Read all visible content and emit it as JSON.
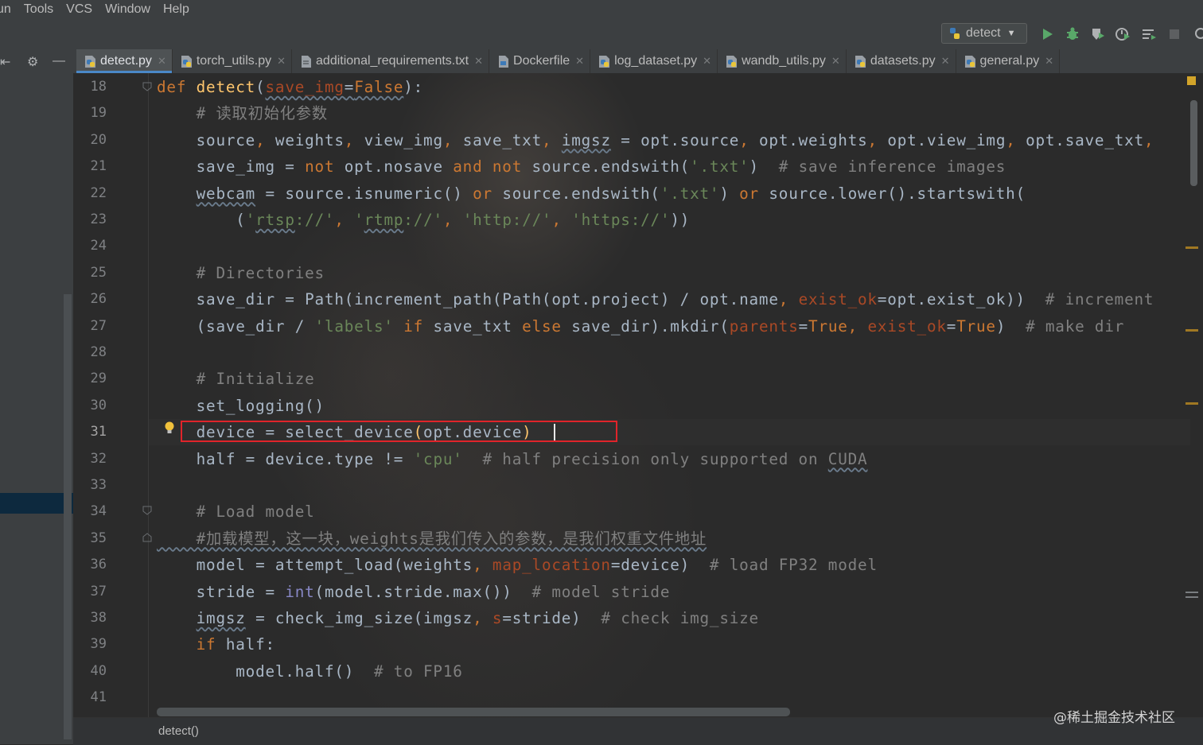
{
  "menu": [
    "un",
    "Tools",
    "VCS",
    "Window",
    "Help"
  ],
  "run_config": {
    "label": "detect",
    "icon": "python-file-icon"
  },
  "toolbar_icons": [
    "run-icon",
    "debug-icon",
    "coverage-icon",
    "profile-icon",
    "build-icon",
    "stop-icon"
  ],
  "tabs": [
    {
      "label": "detect.py",
      "icon": "python-file-icon",
      "active": true
    },
    {
      "label": "torch_utils.py",
      "icon": "python-file-icon"
    },
    {
      "label": "additional_requirements.txt",
      "icon": "text-file-icon"
    },
    {
      "label": "Dockerfile",
      "icon": "docker-file-icon"
    },
    {
      "label": "log_dataset.py",
      "icon": "python-file-icon"
    },
    {
      "label": "wandb_utils.py",
      "icon": "python-file-icon"
    },
    {
      "label": "datasets.py",
      "icon": "python-file-icon"
    },
    {
      "label": "general.py",
      "icon": "python-file-icon"
    }
  ],
  "editor": {
    "current_line": 31,
    "lines": [
      {
        "n": "18",
        "t": [
          [
            "kw",
            "def "
          ],
          [
            "fn",
            "detect"
          ],
          [
            "",
            "("
          ],
          [
            "par wavy",
            "save_img"
          ],
          [
            "wavy",
            "="
          ],
          [
            "kw wavy",
            "False"
          ],
          [
            "",
            "):"
          ]
        ]
      },
      {
        "n": "19",
        "t": [
          [
            "cm",
            "    # 读取初始化参数"
          ]
        ]
      },
      {
        "n": "20",
        "t": [
          [
            "",
            "    source"
          ],
          [
            "kw",
            ", "
          ],
          [
            "",
            "weights"
          ],
          [
            "kw",
            ", "
          ],
          [
            "",
            "view_img"
          ],
          [
            "kw",
            ", "
          ],
          [
            "",
            "save_txt"
          ],
          [
            "kw",
            ", "
          ],
          [
            "wavy",
            "imgsz"
          ],
          [
            "",
            " = opt.source"
          ],
          [
            "kw",
            ", "
          ],
          [
            "",
            "opt.weights"
          ],
          [
            "kw",
            ", "
          ],
          [
            "",
            "opt.view_img"
          ],
          [
            "kw",
            ", "
          ],
          [
            "",
            "opt.save_txt"
          ],
          [
            "kw",
            ","
          ]
        ]
      },
      {
        "n": "21",
        "t": [
          [
            "",
            "    save_img = "
          ],
          [
            "kw",
            "not "
          ],
          [
            "",
            "opt.nosave "
          ],
          [
            "kw",
            "and not "
          ],
          [
            "",
            "source.endswith("
          ],
          [
            "str",
            "'.txt'"
          ],
          [
            "",
            ")  "
          ],
          [
            "cm",
            "# save inference images"
          ]
        ]
      },
      {
        "n": "22",
        "t": [
          [
            "",
            "    "
          ],
          [
            "wavy",
            "webcam"
          ],
          [
            "",
            " = source.isnumeric() "
          ],
          [
            "kw",
            "or "
          ],
          [
            "",
            "source.endswith("
          ],
          [
            "str",
            "'.txt'"
          ],
          [
            "",
            ") "
          ],
          [
            "kw",
            "or "
          ],
          [
            "",
            "source.lower().startswith("
          ]
        ]
      },
      {
        "n": "23",
        "t": [
          [
            "",
            "        ("
          ],
          [
            "str",
            "'"
          ],
          [
            "str wavy",
            "rtsp"
          ],
          [
            "str",
            "://'"
          ],
          [
            "kw",
            ", "
          ],
          [
            "str",
            "'"
          ],
          [
            "str wavy",
            "rtmp"
          ],
          [
            "str",
            "://'"
          ],
          [
            "kw",
            ", "
          ],
          [
            "str",
            "'http://'"
          ],
          [
            "kw",
            ", "
          ],
          [
            "str",
            "'https://'"
          ],
          [
            "",
            "))"
          ]
        ]
      },
      {
        "n": "24",
        "t": []
      },
      {
        "n": "25",
        "t": [
          [
            "cm",
            "    # Directories"
          ]
        ]
      },
      {
        "n": "26",
        "t": [
          [
            "",
            "    save_dir = Path(increment_path(Path(opt.project) / opt.name"
          ],
          [
            "kw",
            ", "
          ],
          [
            "par",
            "exist_ok"
          ],
          [
            "",
            "=opt.exist_ok))  "
          ],
          [
            "cm",
            "# increment"
          ]
        ]
      },
      {
        "n": "27",
        "t": [
          [
            "",
            "    (save_dir / "
          ],
          [
            "str",
            "'labels' "
          ],
          [
            "kw",
            "if "
          ],
          [
            "",
            "save_txt "
          ],
          [
            "kw",
            "else "
          ],
          [
            "",
            "save_dir).mkdir("
          ],
          [
            "par",
            "parents"
          ],
          [
            "",
            "="
          ],
          [
            "kw",
            "True"
          ],
          [
            "kw",
            ", "
          ],
          [
            "par",
            "exist_ok"
          ],
          [
            "",
            "="
          ],
          [
            "kw",
            "True"
          ],
          [
            ")",
            ")  "
          ],
          [
            "cm",
            "# make dir"
          ]
        ]
      },
      {
        "n": "28",
        "t": []
      },
      {
        "n": "29",
        "t": [
          [
            "cm",
            "    # Initialize"
          ]
        ]
      },
      {
        "n": "30",
        "t": [
          [
            "",
            "    set_logging()"
          ]
        ]
      },
      {
        "n": "31",
        "t": [
          [
            "",
            "    device = select_device"
          ],
          [
            "fn",
            "("
          ],
          [
            "",
            "opt.device"
          ],
          [
            "fn",
            ")"
          ]
        ]
      },
      {
        "n": "32",
        "t": [
          [
            "",
            "    half = device.type != "
          ],
          [
            "str",
            "'cpu'  "
          ],
          [
            "cm",
            "# half precision only supported on "
          ],
          [
            "cm wavy",
            "CUDA"
          ]
        ]
      },
      {
        "n": "33",
        "t": []
      },
      {
        "n": "34",
        "t": [
          [
            "cm",
            "    # Load model"
          ]
        ]
      },
      {
        "n": "35",
        "t": [
          [
            "cm wavy",
            "    #加载模型，这一块，weights是我们传入的参数，是我们权重文件地址"
          ]
        ]
      },
      {
        "n": "36",
        "t": [
          [
            "",
            "    model = attempt_load(weights"
          ],
          [
            "kw",
            ", "
          ],
          [
            "par",
            "map_location"
          ],
          [
            "",
            "=device)  "
          ],
          [
            "cm",
            "# load FP32 model"
          ]
        ]
      },
      {
        "n": "37",
        "t": [
          [
            "",
            "    stride = "
          ],
          [
            "bi",
            "int"
          ],
          [
            "",
            "(model.stride.max())  "
          ],
          [
            "cm",
            "# model stride"
          ]
        ]
      },
      {
        "n": "38",
        "t": [
          [
            "",
            "    "
          ],
          [
            "wavy",
            "imgsz"
          ],
          [
            "",
            " = check_img_size(imgsz"
          ],
          [
            "kw",
            ", "
          ],
          [
            "par",
            "s"
          ],
          [
            "",
            "=stride)  "
          ],
          [
            "cm",
            "# check img_size"
          ]
        ]
      },
      {
        "n": "39",
        "t": [
          [
            "kw",
            "    if "
          ],
          [
            "",
            "half:"
          ]
        ]
      },
      {
        "n": "40",
        "t": [
          [
            "",
            "        model.half()  "
          ],
          [
            "cm",
            "# to FP16"
          ]
        ]
      },
      {
        "n": "41",
        "t": []
      }
    ]
  },
  "breadcrumb": "detect()",
  "watermark": "@稀土掘金技术社区",
  "colors": {
    "keyword": "#cc7832",
    "function": "#ffc66d",
    "string": "#6a8759",
    "comment": "#808080",
    "param": "#aa4926",
    "highlight_box": "#e0242a"
  }
}
